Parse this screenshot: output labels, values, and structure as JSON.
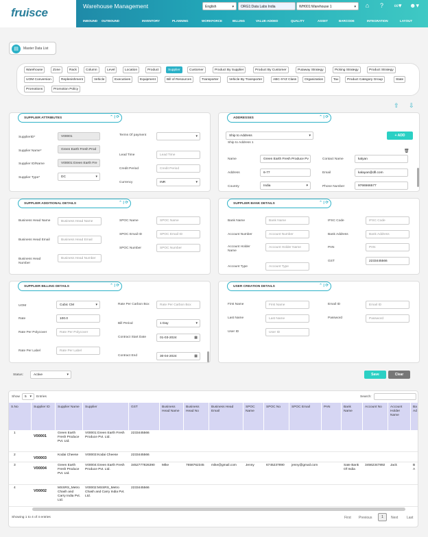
{
  "header": {
    "logo": "fruisce",
    "app_title": "Warehouse Management",
    "language": "English",
    "org": "ORG1:Data Labs India",
    "warehouse": "WH001:Warehouse 1",
    "nav": [
      "INBOUND",
      "OUTBOUND",
      "INVENTORY",
      "PLANNING",
      "WORKFORCE",
      "BILLING",
      "VALUE-ADDED",
      "QUALITY",
      "ASSET",
      "BARCODE",
      "INTEGRATION",
      "LAYOUT"
    ]
  },
  "master_data_list": "Master Data List",
  "tabs": [
    "Warehouse",
    "Zone",
    "Rack",
    "Column",
    "Level",
    "Location",
    "Product",
    "Supplier",
    "Customer",
    "Product By Supplier",
    "Product By Customer",
    "Putaway Strategy",
    "Picking Strategy",
    "Product Strategy",
    "UOM Conversion",
    "Replenishment",
    "Vehicle",
    "Executives",
    "Equipment",
    "Bill of Resources",
    "Transporter",
    "Vehicle By Transporter",
    "ABC-XYZ Class",
    "Organization",
    "Tax",
    "Product Category Group",
    "State",
    "Promotions",
    "Promotion Policy"
  ],
  "active_tab": "Supplier",
  "supplier_attributes": {
    "title": "SUPPLIER ATTRIBUTES",
    "supplier_id_label": "SupplierID*",
    "supplier_id": "V00001",
    "supplier_name_label": "Supplier Name*",
    "supplier_name": "Green Earth Fresh Prod",
    "supplier_id_name_label": "Supplier ID/Name",
    "supplier_id_name": "V00001:Green Earth Fre",
    "supplier_type_label": "Supplier Type*",
    "supplier_type": "DC",
    "terms_label": "Terms Of payment",
    "lead_time_label": "Lead Time",
    "lead_time_ph": "Lead Time",
    "credit_label": "Credit Period",
    "credit_ph": "Credit Period",
    "currency_label": "Currency",
    "currency": "INR"
  },
  "addresses": {
    "title": "ADDRESSES",
    "ship_select": "Ship to Address",
    "ship_text": "Ship to Address 1",
    "add": "+ ADD",
    "name_label": "Name",
    "name": "Green Earth Fresh Produce Pv",
    "address_label": "Address",
    "address": "6-77",
    "country_label": "Country",
    "country": "India",
    "contact_label": "Contact Name",
    "contact": "kalyan",
    "email_label": "Email",
    "email": "kalayan@dll.com",
    "phone_label": "Phone Number",
    "phone": "9766566577"
  },
  "additional": {
    "title": "SUPPLIER ADDITIONAL DETAILS",
    "bh_name_label": "Business Head Name",
    "bh_name_ph": "Business Head Name",
    "bh_email_label": "Business Head Email",
    "bh_email_ph": "Business Head Email",
    "bh_number_label": "Business Head Number",
    "bh_number_ph": "Business Head Number",
    "spoc_name_label": "SPOC Name",
    "spoc_name_ph": "SPOC Name",
    "spoc_email_label": "SPOC Email ID",
    "spoc_email_ph": "SPOC Email ID",
    "spoc_number_label": "SPOC Number",
    "spoc_number_ph": "SPOC Number"
  },
  "bank": {
    "title": "SUPPLIER BANK DETAILS",
    "bank_name_label": "Bank Name",
    "bank_name_ph": "Bank Name",
    "acc_no_label": "Account Number",
    "acc_no_ph": "Account Number",
    "holder_label": "Account Holder Name",
    "holder_ph": "Account Holder Name",
    "acc_type_label": "Account Type",
    "acc_type_ph": "Account Type",
    "ifsc_label": "IFSC Code",
    "ifsc_ph": "IFSC Code",
    "bank_addr_label": "Bank Address",
    "bank_addr_ph": "Bank Address",
    "pan_label": "PAN",
    "pan_ph": "PAN",
    "gst_label": "GST",
    "gst": "2233445566"
  },
  "billing": {
    "title": "SUPPLIER BILLING DETAILS",
    "uom_label": "UOM",
    "uom": "Cubic CM",
    "rate_label": "Rate",
    "rate": "100.0",
    "polycover_label": "Rate Per Polycover",
    "polycover_ph": "Rate Per Polycover",
    "per_label_label": "Rate Per Label",
    "per_label_ph": "Rate Per Label",
    "carbon_label": "Rate Per Carbon Box",
    "carbon_ph": "Rate Per Carbon Box",
    "bill_period_label": "Bill Period",
    "bill_period": "1 Day",
    "start_label": "Contract Start Date",
    "start": "01-03-2024",
    "end_label": "Contract End",
    "end": "30-04-2024"
  },
  "user_creation": {
    "title": "USER CREATION DETAILS",
    "first_label": "First Name",
    "first_ph": "First Name",
    "last_label": "Last Name",
    "last_ph": "Last Name",
    "userid_label": "User ID",
    "userid_ph": "User ID",
    "email_label": "Email ID",
    "email_ph": "Email ID",
    "pwd_label": "Password",
    "pwd_ph": "Password"
  },
  "status_label": "Status:",
  "status": "Active",
  "save": "Save",
  "clear": "Clear",
  "table": {
    "show": "Show",
    "show_count": "5",
    "entries": "Entries",
    "search": "Search:",
    "columns": [
      "S.No",
      "Supplier ID",
      "Supplier Name",
      "Supplier",
      "GST",
      "Business Head Name",
      "Business Head No",
      "Business Head Email",
      "SPOC Name",
      "SPOC No",
      "SPOC Email",
      "PAN",
      "Bank Name",
      "Account No",
      "Account Holder Name",
      "Ba Ad"
    ],
    "rows": [
      [
        "1",
        "V00001",
        "Green Earth Fresh Produce Pvt. Ltd.",
        "V00001:Green Earth Fresh Produce Pvt. Ltd.",
        "2233445566",
        "",
        "",
        "",
        "",
        "",
        "",
        "",
        "",
        "",
        "",
        ""
      ],
      [
        "2",
        "V00003",
        "Kodai Cheese",
        "V00003:Kodai Cheese",
        "2233445566",
        "",
        "",
        "",
        "",
        "",
        "",
        "",
        "",
        "",
        "",
        ""
      ],
      [
        "3",
        "V00004",
        "Green Earth Fresh Produce Pvt. Ltd.",
        "V00004:Green Earth Fresh Produce Pvt. Ltd.",
        "3452777826390",
        "Mike",
        "7658762345",
        "mike@gmail.com",
        "Jenny",
        "6745237890",
        "jenny@gmail.com",
        "",
        "Sate Bank Of India",
        "34562347892",
        "Jack",
        "B A"
      ],
      [
        "4",
        "V00002",
        "MSSRS_Metro Chash and Carry India Pvt. Ltd.",
        "V00002:MSSRS_Metro Chash and Carry India Pvt. Ltd.",
        "2233445566",
        "",
        "",
        "",
        "",
        "",
        "",
        "",
        "",
        "",
        "",
        ""
      ]
    ],
    "info": "Showing 1 to 4 of 4 entries",
    "first": "First",
    "previous": "Previous",
    "page": "1",
    "next": "Next",
    "last": "Last"
  },
  "colors": {
    "teal": "#2bb1c7",
    "save": "#2bd0c4",
    "clear": "#777777",
    "header_th": "#d6d6f3"
  }
}
